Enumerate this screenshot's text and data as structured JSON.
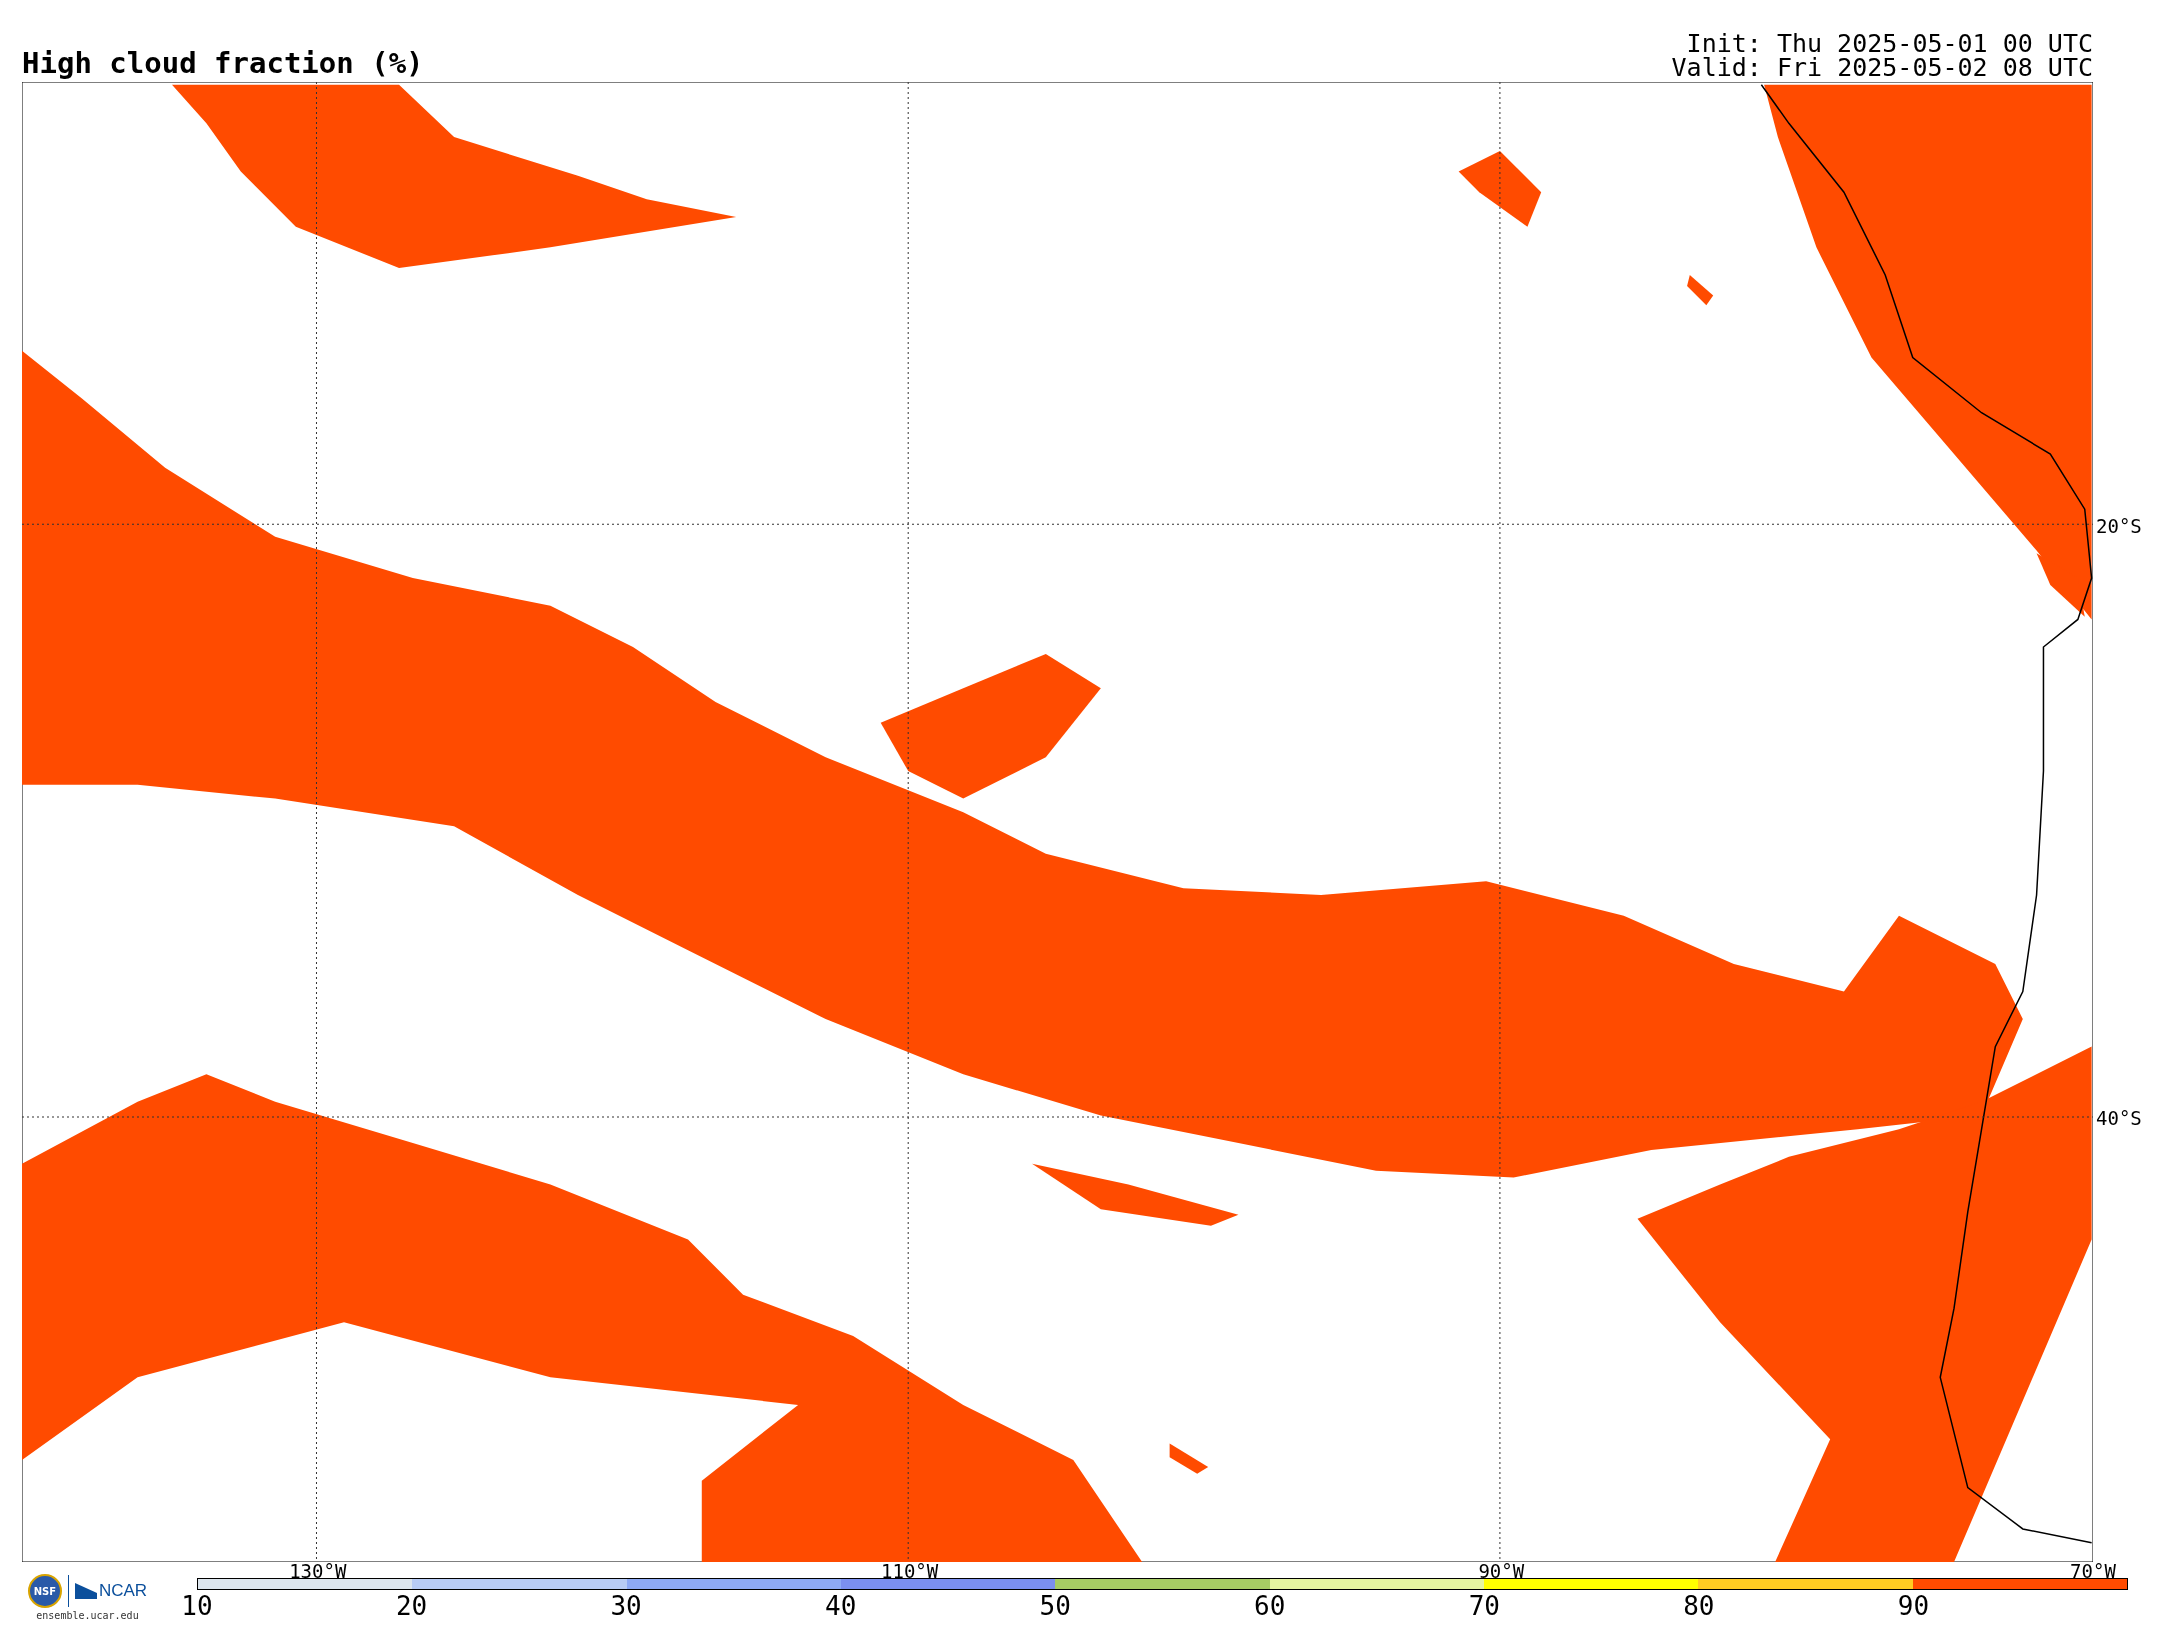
{
  "title": "High cloud fraction (%)",
  "run_info": [
    "Init: Thu 2025-05-01 00 UTC",
    "Valid: Fri 2025-05-02 08 UTC"
  ],
  "map": {
    "lat_labels": [
      "20°S",
      "40°S"
    ],
    "lon_labels": [
      "130°W",
      "110°W",
      "90°W",
      "70°W"
    ]
  },
  "logo": {
    "seal": "NSF",
    "org": "NCAR",
    "url": "ensemble.ucar.edu"
  },
  "colorbar": {
    "bins": [
      {
        "color": "#dde6ee"
      },
      {
        "color": "#b8ccf5"
      },
      {
        "color": "#8eaaf5"
      },
      {
        "color": "#7b8ff0"
      },
      {
        "color": "#a6cc64"
      },
      {
        "color": "#e5f5a0"
      },
      {
        "color": "#ffff00"
      },
      {
        "color": "#ffcc22"
      },
      {
        "color": "#ff4b00"
      }
    ],
    "ticks": [
      "10",
      "20",
      "30",
      "40",
      "50",
      "60",
      "70",
      "80",
      "90"
    ]
  }
}
